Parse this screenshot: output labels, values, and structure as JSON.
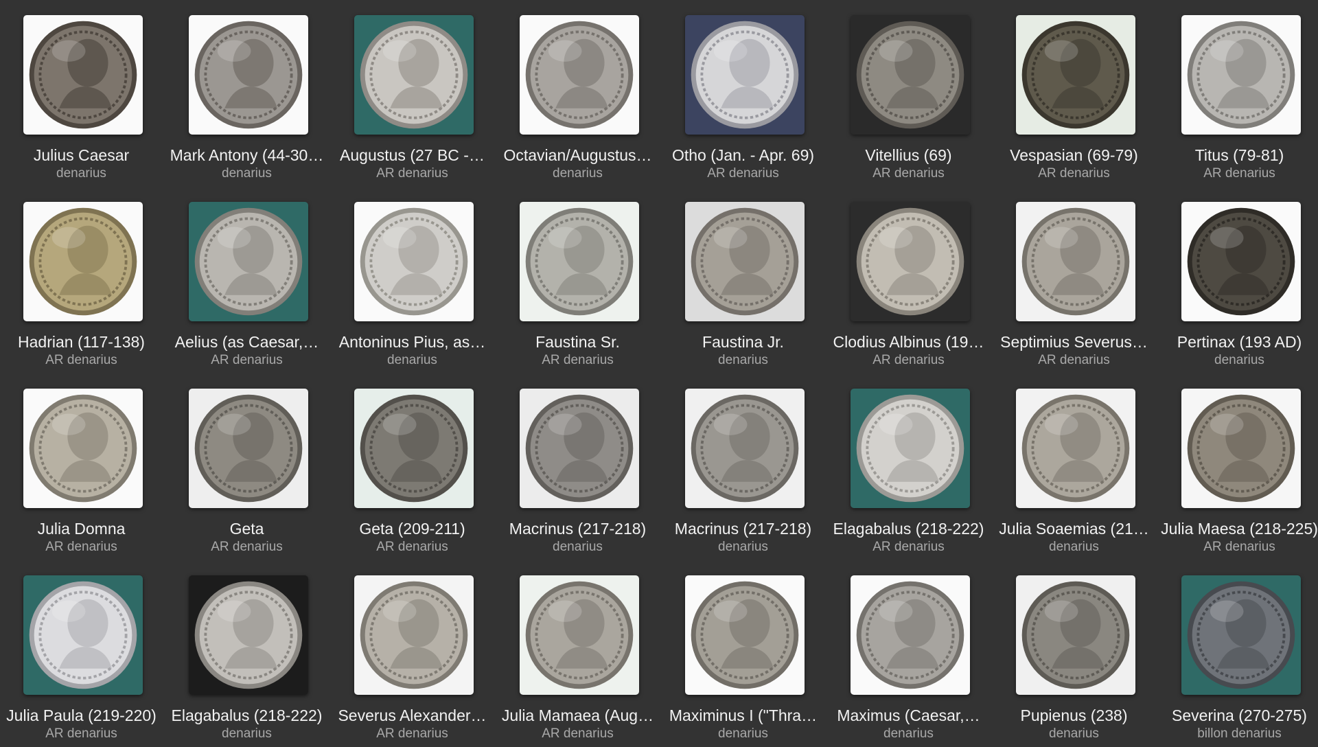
{
  "items": [
    {
      "title": "Julius Caesar",
      "subtitle": "denarius",
      "bg": "#fafafa",
      "coin": "#7d756c",
      "rim": "#4e4740",
      "face": "#5e574f"
    },
    {
      "title": "Mark Antony (44-30…",
      "subtitle": "denarius",
      "bg": "#fafafa",
      "coin": "#9b9792",
      "rim": "#6a6560",
      "face": "#7d7872"
    },
    {
      "title": "Augustus (27 BC -…",
      "subtitle": "AR denarius",
      "bg": "#2f6a66",
      "coin": "#c9c6c1",
      "rim": "#8f8b86",
      "face": "#a8a49e"
    },
    {
      "title": "Octavian/Augustus…",
      "subtitle": "denarius",
      "bg": "#fafafa",
      "coin": "#a8a49f",
      "rim": "#76726d",
      "face": "#8c8883"
    },
    {
      "title": "Otho (Jan. - Apr. 69)",
      "subtitle": "AR denarius",
      "bg": "#3c4460",
      "coin": "#d6d6d8",
      "rim": "#9a9aa0",
      "face": "#b8b8bd"
    },
    {
      "title": "Vitellius (69)",
      "subtitle": "AR denarius",
      "bg": "#2a2a2a",
      "coin": "#8e8a82",
      "rim": "#5f5b55",
      "face": "#75716a"
    },
    {
      "title": "Vespasian (69-79)",
      "subtitle": "AR denarius",
      "bg": "#e6ece4",
      "coin": "#5f5a4c",
      "rim": "#3b372e",
      "face": "#4c483d"
    },
    {
      "title": "Titus (79-81)",
      "subtitle": "AR denarius",
      "bg": "#fafafa",
      "coin": "#b8b6b2",
      "rim": "#807e7a",
      "face": "#9a9894"
    },
    {
      "title": "Hadrian (117-138)",
      "subtitle": "AR denarius",
      "bg": "#fafafa",
      "coin": "#b5a77c",
      "rim": "#7f7352",
      "face": "#9a8d65"
    },
    {
      "title": "Aelius (as Caesar,…",
      "subtitle": "AR denarius",
      "bg": "#2f6a66",
      "coin": "#b9b6b0",
      "rim": "#827f79",
      "face": "#9d9a94"
    },
    {
      "title": "Antoninus Pius, as…",
      "subtitle": "denarius",
      "bg": "#fafafa",
      "coin": "#cfcdc9",
      "rim": "#98968f",
      "face": "#b3b0ab"
    },
    {
      "title": "Faustina Sr.",
      "subtitle": "AR denarius",
      "bg": "#eef2ee",
      "coin": "#b3b2ab",
      "rim": "#7f7e78",
      "face": "#999891"
    },
    {
      "title": "Faustina Jr.",
      "subtitle": "denarius",
      "bg": "#dcdcdc",
      "coin": "#a5a097",
      "rim": "#75706a",
      "face": "#8c877f"
    },
    {
      "title": "Clodius Albinus (19…",
      "subtitle": "AR denarius",
      "bg": "#2c2c2c",
      "coin": "#c2bdb3",
      "rim": "#8a857c",
      "face": "#a5a097"
    },
    {
      "title": "Septimius Severus…",
      "subtitle": "AR denarius",
      "bg": "#f2f2f2",
      "coin": "#aaa59c",
      "rim": "#77736b",
      "face": "#8f8a82"
    },
    {
      "title": "Pertinax (193 AD)",
      "subtitle": "denarius",
      "bg": "#fafafa",
      "coin": "#4e4a42",
      "rim": "#2f2c27",
      "face": "#3e3a34"
    },
    {
      "title": "Julia Domna",
      "subtitle": "AR denarius",
      "bg": "#fafafa",
      "coin": "#b7b1a3",
      "rim": "#807b70",
      "face": "#9b9588"
    },
    {
      "title": "Geta",
      "subtitle": "AR denarius",
      "bg": "#eeeeee",
      "coin": "#8e8a82",
      "rim": "#615e58",
      "face": "#77736c"
    },
    {
      "title": "Geta (209-211)",
      "subtitle": "AR denarius",
      "bg": "#e6eeea",
      "coin": "#7d7a73",
      "rim": "#53504b",
      "face": "#67645e"
    },
    {
      "title": "Macrinus (217-218)",
      "subtitle": "denarius",
      "bg": "#ececec",
      "coin": "#8f8c88",
      "rim": "#63605c",
      "face": "#797672"
    },
    {
      "title": "Macrinus (217-218)",
      "subtitle": "denarius",
      "bg": "#f0f0f0",
      "coin": "#9a9791",
      "rim": "#6b6863",
      "face": "#84817b"
    },
    {
      "title": "Elagabalus (218-222)",
      "subtitle": "AR denarius",
      "bg": "#2f6a66",
      "coin": "#d3d1cd",
      "rim": "#9c9a96",
      "face": "#b6b4b0"
    },
    {
      "title": "Julia Soaemias (21…",
      "subtitle": "denarius",
      "bg": "#f2f2f2",
      "coin": "#aca79d",
      "rim": "#79746b",
      "face": "#918c83"
    },
    {
      "title": "Julia Maesa (218-225)",
      "subtitle": "AR denarius",
      "bg": "#f6f6f6",
      "coin": "#8f887c",
      "rim": "#625c52",
      "face": "#787166"
    },
    {
      "title": "Julia Paula (219-220)",
      "subtitle": "AR denarius",
      "bg": "#2f6a66",
      "coin": "#dcdcdf",
      "rim": "#a4a4a8",
      "face": "#c0c0c4"
    },
    {
      "title": "Elagabalus (218-222)",
      "subtitle": "denarius",
      "bg": "#1c1c1c",
      "coin": "#c2bfba",
      "rim": "#8a8782",
      "face": "#a6a39e"
    },
    {
      "title": "Severus Alexander…",
      "subtitle": "AR denarius",
      "bg": "#f4f4f4",
      "coin": "#b6b1a8",
      "rim": "#7f7b73",
      "face": "#9a968d"
    },
    {
      "title": "Julia Mamaea (Aug…",
      "subtitle": "AR denarius",
      "bg": "#eef2ee",
      "coin": "#aaa69e",
      "rim": "#78746d",
      "face": "#908c85"
    },
    {
      "title": "Maximinus I (\"Thra…",
      "subtitle": "denarius",
      "bg": "#fafafa",
      "coin": "#a39f96",
      "rim": "#726e67",
      "face": "#8a867e"
    },
    {
      "title": "Maximus (Caesar,…",
      "subtitle": "denarius",
      "bg": "#fafafa",
      "coin": "#a7a49f",
      "rim": "#75726d",
      "face": "#8e8b86"
    },
    {
      "title": "Pupienus (238)",
      "subtitle": "denarius",
      "bg": "#f0f0f0",
      "coin": "#8a8780",
      "rim": "#5e5b55",
      "face": "#74716b"
    },
    {
      "title": "Severina (270-275)",
      "subtitle": "billon denarius",
      "bg": "#2f6a66",
      "coin": "#6f7379",
      "rim": "#474a4f",
      "face": "#5b5f64"
    }
  ]
}
